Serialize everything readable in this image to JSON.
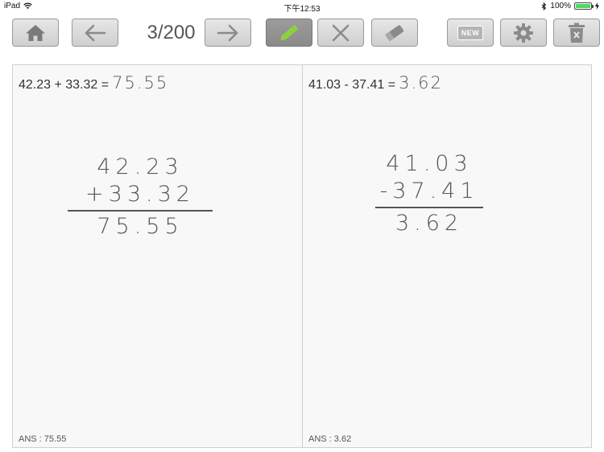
{
  "status_bar": {
    "device": "iPad",
    "time": "下午12:53",
    "battery_text": "100%",
    "battery_level": 1.0
  },
  "toolbar": {
    "counter": "3/200",
    "new_label": "NEW",
    "icons": [
      "home-icon",
      "arrow-left-icon",
      "arrow-right-icon",
      "pencil-icon",
      "x-clear-icon",
      "eraser-icon",
      "new-icon",
      "gear-icon",
      "trash-icon"
    ],
    "pencil_color": "#8ed13f"
  },
  "problems": [
    {
      "expression": "42.23 + 33.32 =",
      "handwritten_answer": "75.55",
      "work": {
        "line1": "42.23",
        "line2": "+33.32",
        "result": "75.55"
      },
      "ans_label": "ANS : 75.55"
    },
    {
      "expression": "41.03 - 37.41 =",
      "handwritten_answer": "3.62",
      "work": {
        "line1": "41.03",
        "line2": "-37.41",
        "result": "3.62"
      },
      "ans_label": "ANS : 3.62"
    }
  ]
}
